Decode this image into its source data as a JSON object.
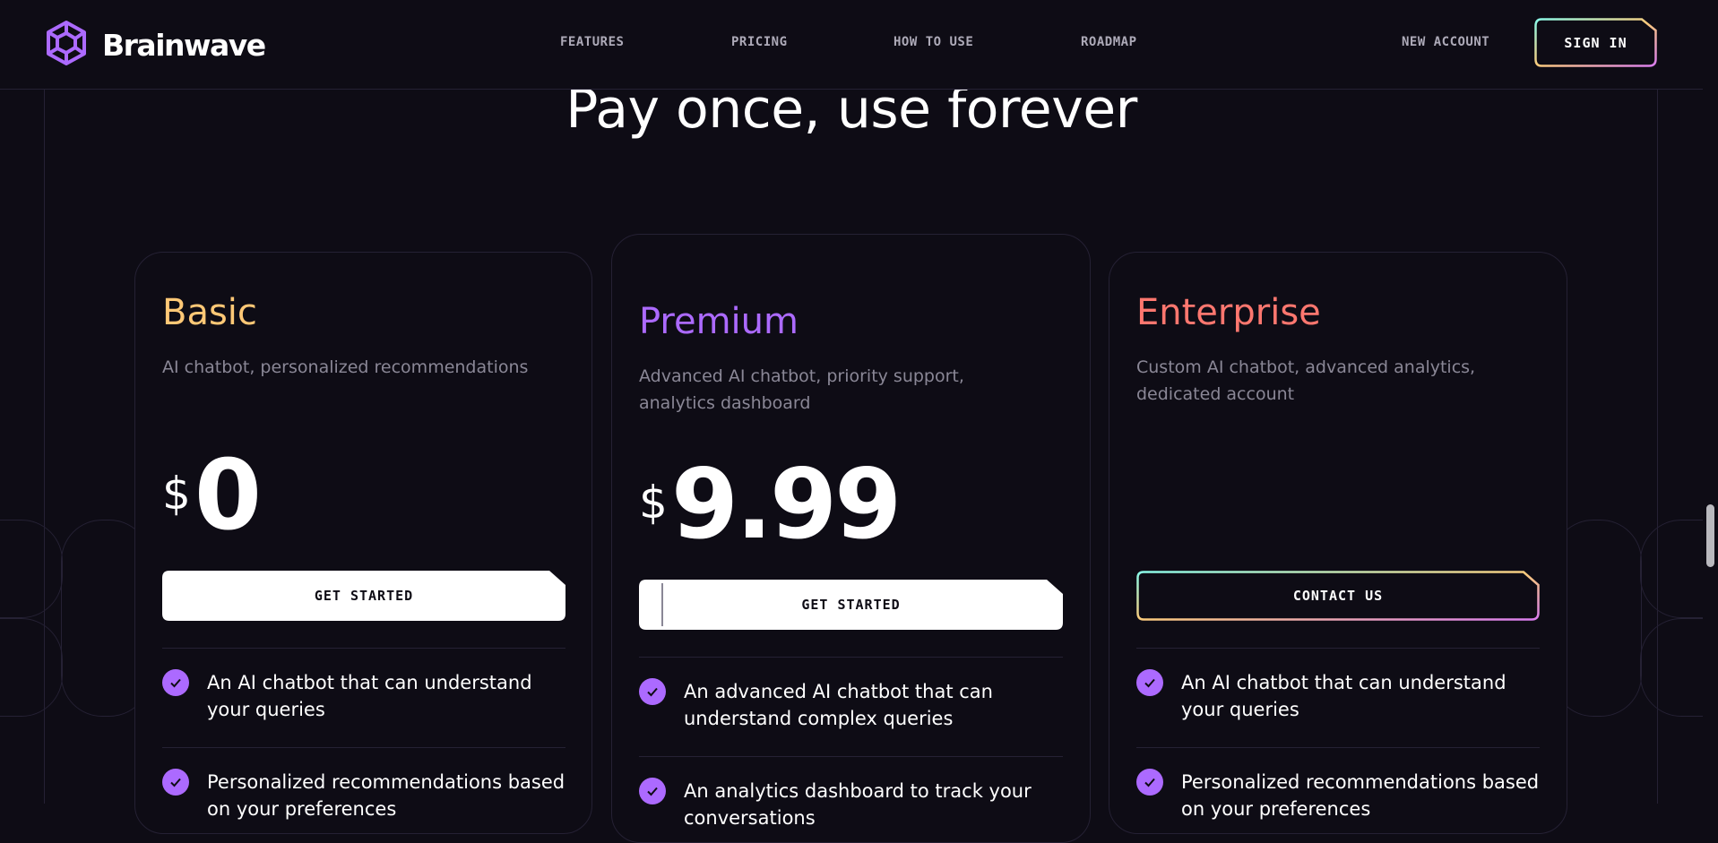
{
  "header": {
    "brand": "Brainwave",
    "nav": [
      {
        "label": "FEATURES"
      },
      {
        "label": "PRICING"
      },
      {
        "label": "HOW TO USE"
      },
      {
        "label": "ROADMAP"
      }
    ],
    "new_account": "NEW ACCOUNT",
    "sign_in": "SIGN IN"
  },
  "pricing": {
    "title": "Pay once, use forever",
    "plans": [
      {
        "name": "Basic",
        "name_color": "#ffc876",
        "description": "AI chatbot, personalized recommendations",
        "currency": "$",
        "price": "0",
        "cta": "GET STARTED",
        "features": [
          "An AI chatbot that can understand your queries",
          "Personalized recommendations based on your preferences"
        ]
      },
      {
        "name": "Premium",
        "name_color": "#ac6aff",
        "description": "Advanced AI chatbot, priority support, analytics dashboard",
        "currency": "$",
        "price": "9.99",
        "cta": "GET STARTED",
        "features": [
          "An advanced AI chatbot that can understand complex queries",
          "An analytics dashboard to track your conversations"
        ]
      },
      {
        "name": "Enterprise",
        "name_color": "#ff776f",
        "description": "Custom AI chatbot, advanced analytics, dedicated account",
        "cta": "CONTACT US",
        "features": [
          "An AI chatbot that can understand your queries",
          "Personalized recommendations based on your preferences"
        ]
      }
    ]
  },
  "colors": {
    "background": "#0e0c15",
    "stroke": "#252134",
    "accent": "#ac6aff"
  }
}
